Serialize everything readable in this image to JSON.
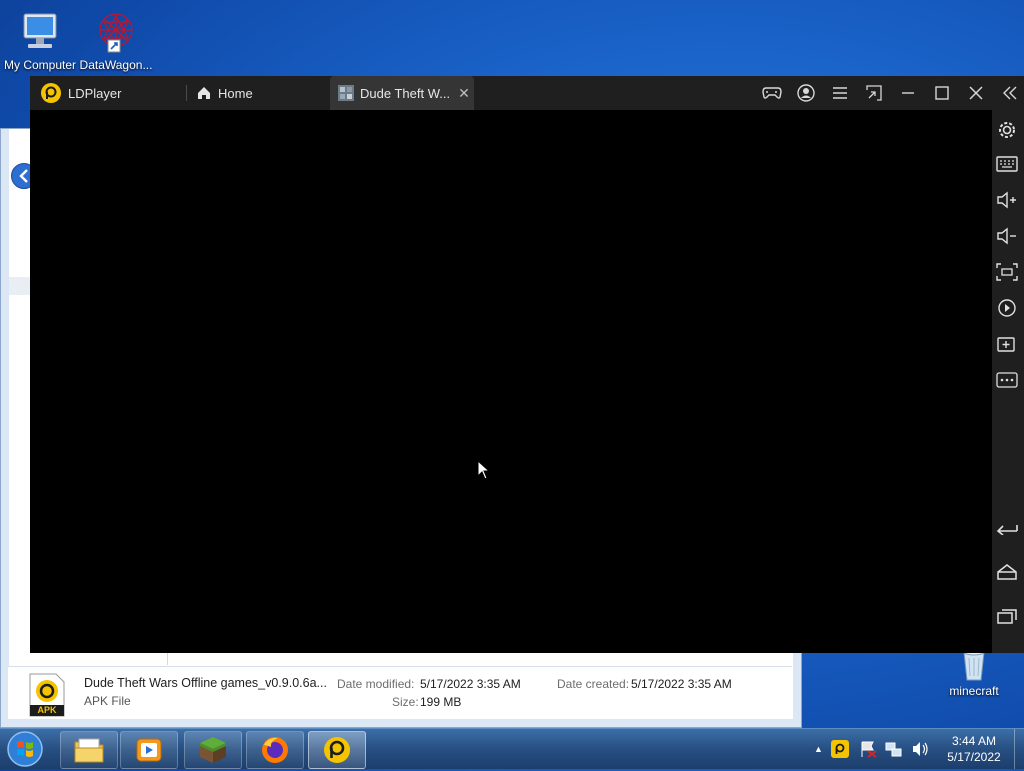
{
  "desktop": {
    "icons": [
      {
        "label": "My Computer"
      },
      {
        "label": "DataWagon..."
      },
      {
        "label": "minecraft"
      }
    ]
  },
  "ldplayer": {
    "app_name": "LDPlayer",
    "tabs": [
      {
        "label": "Home"
      },
      {
        "label": "Dude Theft W..."
      }
    ],
    "toolbar_icons": [
      "gamepad-icon",
      "account-icon",
      "menu-icon",
      "shrink-icon",
      "minimize-icon",
      "maximize-icon",
      "close-icon",
      "collapse-sidebar-icon"
    ],
    "sidebar_icons": [
      "settings-icon",
      "keyboard-icon",
      "volume-up-icon",
      "volume-down-icon",
      "screenshot-icon",
      "rotate-icon",
      "add-apk-icon",
      "more-icon",
      "back-icon",
      "home-icon",
      "recent-apps-icon"
    ]
  },
  "explorer_details": {
    "file_name": "Dude Theft Wars Offline games_v0.9.0.6a...",
    "file_type": "APK File",
    "icon_label": "APK",
    "date_modified_label": "Date modified:",
    "date_modified": "5/17/2022 3:35 AM",
    "date_created_label": "Date created:",
    "date_created": "5/17/2022 3:35 AM",
    "size_label": "Size:",
    "size": "199 MB"
  },
  "taskbar": {
    "apps": [
      "file-explorer-icon",
      "media-player-icon",
      "minecraft-icon",
      "firefox-icon",
      "ldplayer-icon"
    ],
    "clock_time": "3:44 AM",
    "clock_date": "5/17/2022"
  },
  "colors": {
    "ldplayer_accent": "#f5c400",
    "titlebar": "#1f1f1f",
    "desktop_blue": "#1a63c9"
  }
}
